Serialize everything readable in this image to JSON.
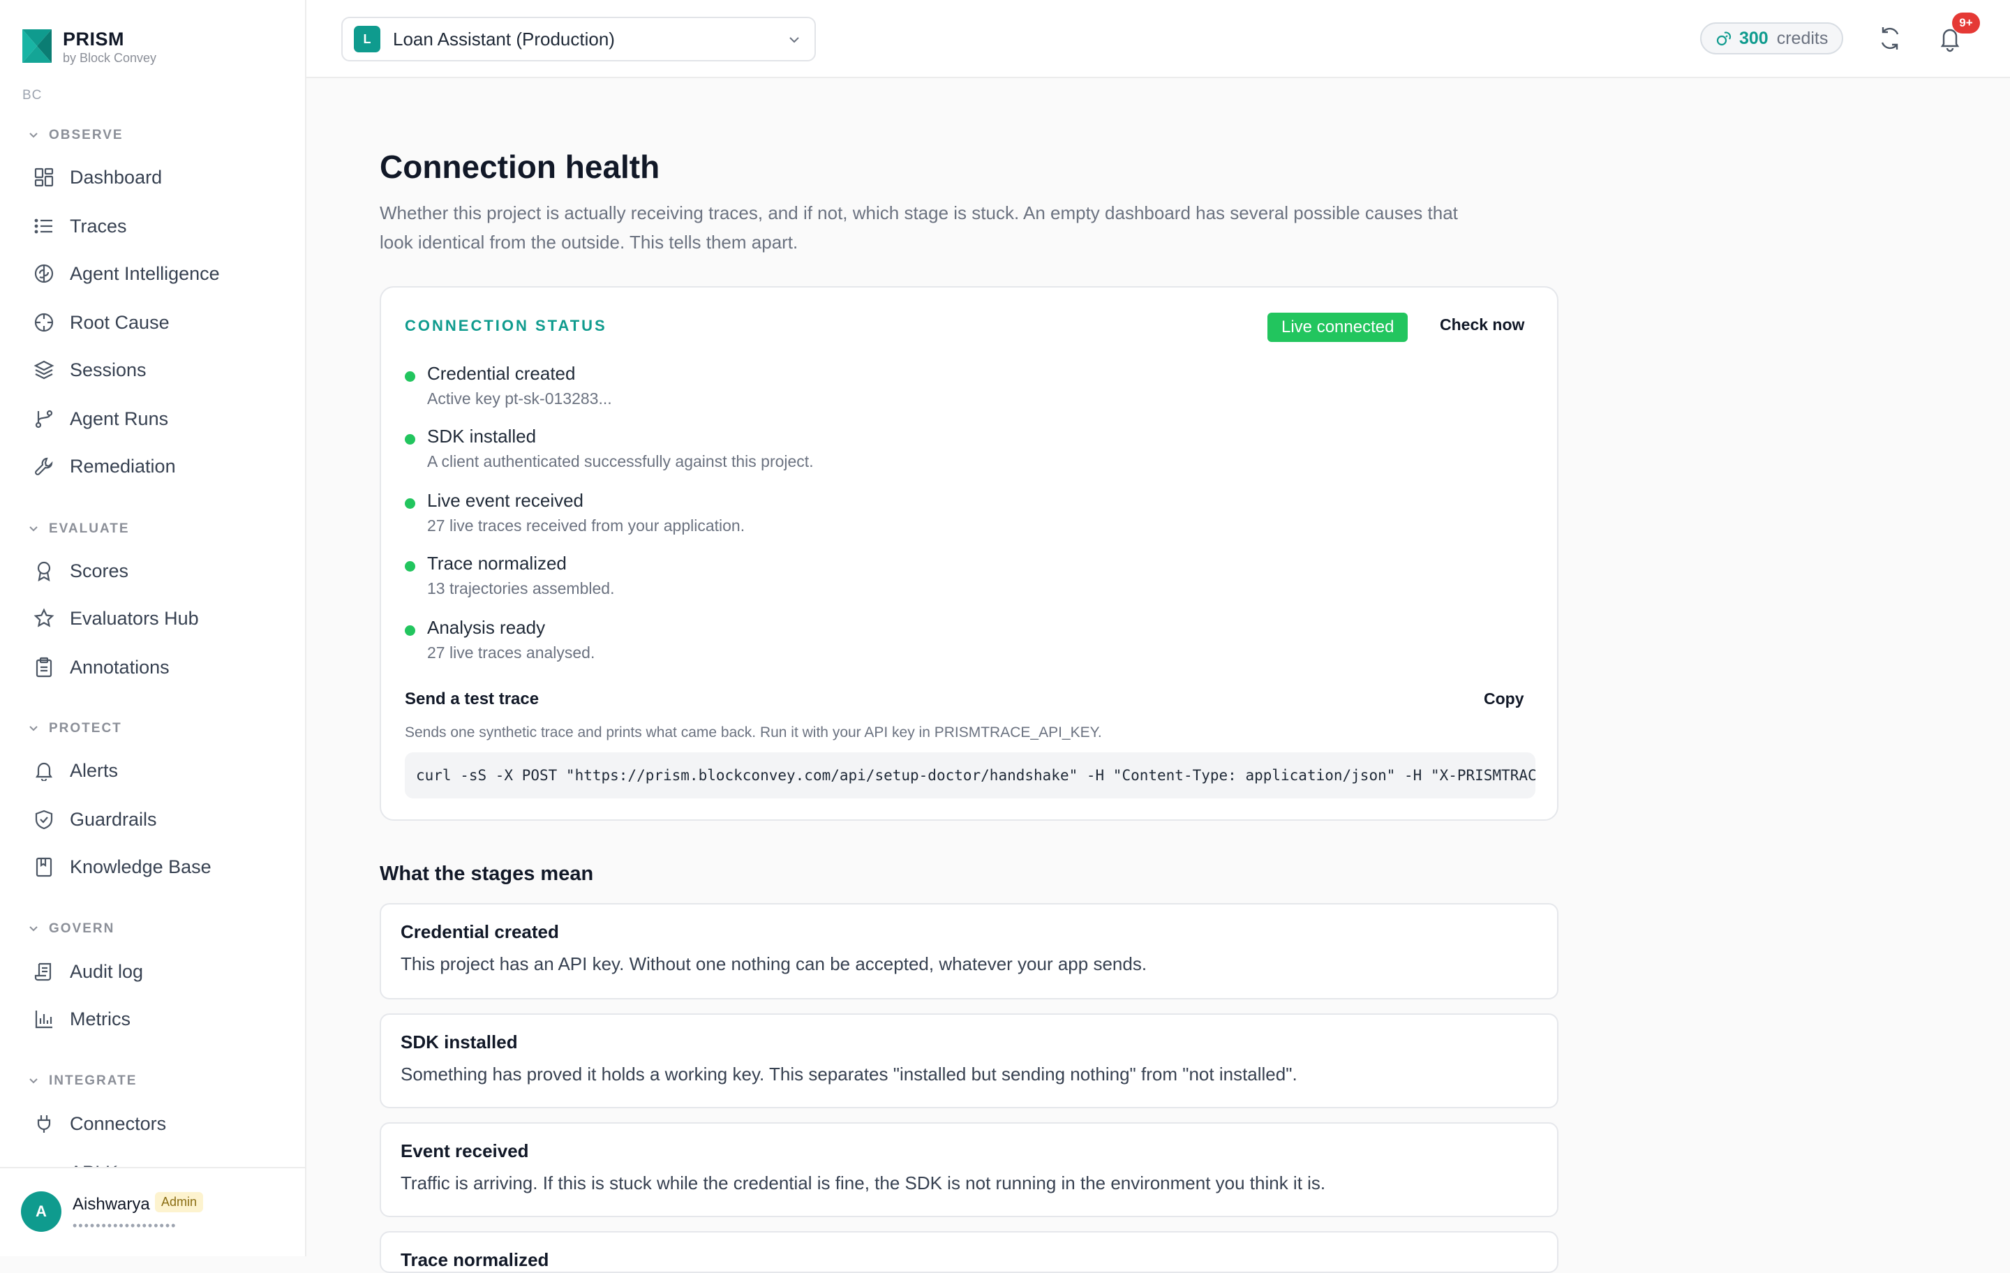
{
  "brand": {
    "name": "PRISM",
    "sub": "by Block Convey",
    "workspace": "BC",
    "accent": "#0f9b8e"
  },
  "sidebar": {
    "observe": {
      "label": "OBSERVE",
      "items": [
        {
          "label": "Dashboard",
          "icon": "dashboard-icon"
        },
        {
          "label": "Traces",
          "icon": "list-icon"
        },
        {
          "label": "Agent Intelligence",
          "icon": "brain-icon"
        },
        {
          "label": "Root Cause",
          "icon": "crosshair-icon"
        },
        {
          "label": "Sessions",
          "icon": "layers-icon"
        },
        {
          "label": "Agent Runs",
          "icon": "branch-icon"
        },
        {
          "label": "Remediation",
          "icon": "wrench-icon"
        }
      ]
    },
    "evaluate": {
      "label": "EVALUATE",
      "items": [
        {
          "label": "Scores",
          "icon": "award-icon"
        },
        {
          "label": "Evaluators Hub",
          "icon": "star-icon"
        },
        {
          "label": "Annotations",
          "icon": "clipboard-icon"
        }
      ]
    },
    "protect": {
      "label": "PROTECT",
      "items": [
        {
          "label": "Alerts",
          "icon": "bell-icon"
        },
        {
          "label": "Guardrails",
          "icon": "shield-icon"
        },
        {
          "label": "Knowledge Base",
          "icon": "book-icon"
        }
      ]
    },
    "govern": {
      "label": "GOVERN",
      "items": [
        {
          "label": "Audit log",
          "icon": "scroll-icon"
        },
        {
          "label": "Metrics",
          "icon": "bar-chart-icon"
        }
      ]
    },
    "integrate": {
      "label": "INTEGRATE",
      "items": [
        {
          "label": "Connectors",
          "icon": "plug-icon"
        },
        {
          "label": "API K",
          "icon": "key-icon"
        }
      ]
    }
  },
  "user": {
    "initial": "A",
    "name": "Aishwarya",
    "role": "Admin",
    "masked": "••••••••••••••••••"
  },
  "topbar": {
    "project_badge": "L",
    "project_name": "Loan Assistant (Production)",
    "credits_value": "300",
    "credits_label": "credits",
    "notifications": "9+"
  },
  "page": {
    "title": "Connection health",
    "description": "Whether this project is actually receiving traces, and if not, which stage is stuck. An empty dashboard has several possible causes that look identical from the outside. This tells them apart."
  },
  "status_card": {
    "label": "CONNECTION STATUS",
    "badge": "Live connected",
    "check_label": "Check now",
    "status_color": "#22c55e",
    "stages": [
      {
        "title": "Credential created",
        "detail": "Active key pt-sk-013283..."
      },
      {
        "title": "SDK installed",
        "detail": "A client authenticated successfully against this project."
      },
      {
        "title": "Live event received",
        "detail": "27 live traces received from your application."
      },
      {
        "title": "Trace normalized",
        "detail": "13 trajectories assembled."
      },
      {
        "title": "Analysis ready",
        "detail": "27 live traces analysed."
      }
    ],
    "test": {
      "title": "Send a test trace",
      "copy_label": "Copy",
      "description": "Sends one synthetic trace and prints what came back. Run it with your API key in PRISMTRACE_API_KEY.",
      "command": "curl -sS -X POST \"https://prism.blockconvey.com/api/setup-doctor/handshake\" -H \"Content-Type: application/json\" -H \"X-PRISMTRACE-API-KEY: $PRISMTRACE_API_KEY\""
    }
  },
  "stages_meaning": {
    "title": "What the stages mean",
    "items": [
      {
        "title": "Credential created",
        "text": "This project has an API key. Without one nothing can be accepted, whatever your app sends."
      },
      {
        "title": "SDK installed",
        "text": "Something has proved it holds a working key. This separates \"installed but sending nothing\" from \"not installed\"."
      },
      {
        "title": "Event received",
        "text": "Traffic is arriving. If this is stuck while the credential is fine, the SDK is not running in the environment you think it is."
      },
      {
        "title": "Trace normalized",
        "text": ""
      }
    ]
  }
}
